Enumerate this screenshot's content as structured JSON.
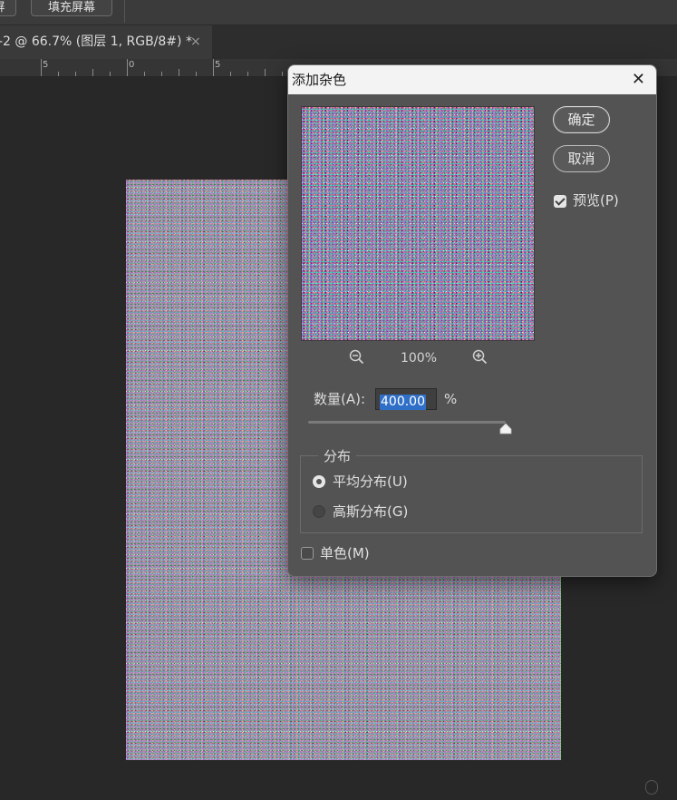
{
  "option_bar": {
    "button_partial_label": "屏",
    "fill_screen_label": "填充屏幕"
  },
  "document_tab": {
    "title": "-2 @ 66.7% (图层 1, RGB/8#) *",
    "close_glyph": "×"
  },
  "ruler": {
    "labels": [
      "5",
      "0",
      "5"
    ]
  },
  "dialog": {
    "title": "添加杂色",
    "close_glyph": "✕",
    "ok_label": "确定",
    "cancel_label": "取消",
    "preview_label": "预览(P)",
    "preview_checked": true,
    "zoom_value": "100%",
    "amount_label": "数量(A):",
    "amount_value": "400.00",
    "amount_unit": "%",
    "amount_slider_fraction": 1.0,
    "distribution": {
      "legend": "分布",
      "uniform_label": "平均分布(U)",
      "gaussian_label": "高斯分布(G)",
      "selected": "uniform"
    },
    "monochromatic_label": "单色(M)",
    "monochromatic_checked": false
  },
  "colors": {
    "dialog_bg": "#535353",
    "workspace_bg": "#282828",
    "selection": "#2f6fc7"
  }
}
